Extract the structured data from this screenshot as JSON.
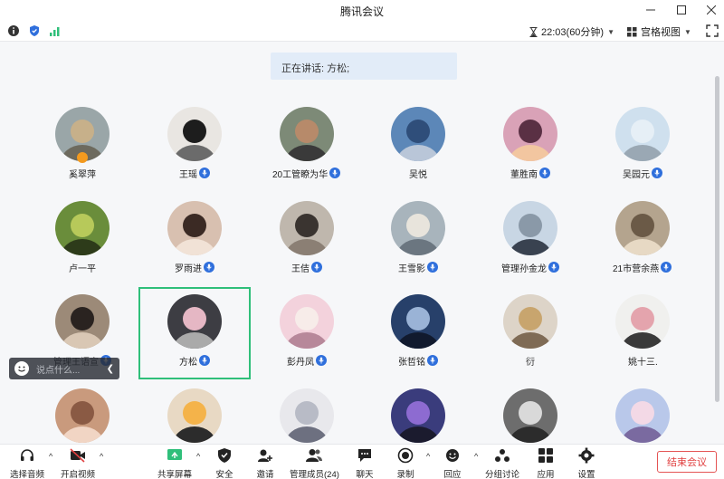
{
  "window": {
    "title": "腾讯会议",
    "min": "—",
    "max": "☐",
    "close": "✕"
  },
  "infobar": {
    "timer": "22:03(60分钟)",
    "view_mode": "宫格视图"
  },
  "speaking": "正在讲话: 方松;",
  "participants": [
    {
      "name": "奚翠萍",
      "mic": false,
      "host": true
    },
    {
      "name": "王瑶",
      "mic": true
    },
    {
      "name": "20工管瞭为华",
      "mic": true
    },
    {
      "name": "吴悦",
      "mic": false
    },
    {
      "name": "董胜南",
      "mic": true
    },
    {
      "name": "吴园元",
      "mic": true
    },
    {
      "name": "卢一平",
      "mic": false
    },
    {
      "name": "罗雨进",
      "mic": true
    },
    {
      "name": "王佶",
      "mic": true
    },
    {
      "name": "王雪影",
      "mic": true
    },
    {
      "name": "管理孙金龙",
      "mic": true
    },
    {
      "name": "21市营余燕",
      "mic": true
    },
    {
      "name": "管理王语宣",
      "mic": true
    },
    {
      "name": "方松",
      "mic": true,
      "active": true
    },
    {
      "name": "彭丹凤",
      "mic": true
    },
    {
      "name": "张哲铭",
      "mic": true
    },
    {
      "name": "衍",
      "mic": false
    },
    {
      "name": "姚十三.",
      "mic": false
    },
    {
      "name": "",
      "mic": false
    },
    {
      "name": "",
      "mic": false
    },
    {
      "name": "",
      "mic": false
    },
    {
      "name": "",
      "mic": false
    },
    {
      "name": "",
      "mic": false
    },
    {
      "name": "",
      "mic": false
    }
  ],
  "chat": {
    "placeholder": "说点什么..."
  },
  "toolbar": {
    "items": [
      {
        "label": "选择音频",
        "icon": "headset-icon"
      },
      {
        "label": "开启视频",
        "icon": "camera-off-icon"
      },
      {
        "label": "共享屏幕",
        "icon": "share-screen-icon"
      },
      {
        "label": "安全",
        "icon": "shield-icon"
      },
      {
        "label": "邀请",
        "icon": "invite-icon"
      },
      {
        "label": "管理成员(24)",
        "icon": "members-icon"
      },
      {
        "label": "聊天",
        "icon": "chat-icon"
      },
      {
        "label": "录制",
        "icon": "record-icon"
      },
      {
        "label": "回应",
        "icon": "reaction-icon"
      },
      {
        "label": "分组讨论",
        "icon": "breakout-icon"
      },
      {
        "label": "应用",
        "icon": "apps-icon"
      },
      {
        "label": "设置",
        "icon": "gear-icon"
      }
    ],
    "end": "结束会议"
  },
  "colors": {
    "accent": "#2f6fdc",
    "active_border": "#2fbf7a",
    "end": "#e14040",
    "banner": "#e2ecf8"
  }
}
